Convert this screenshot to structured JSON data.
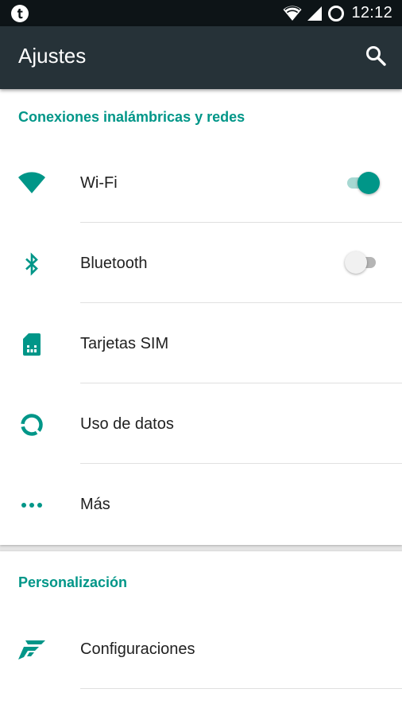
{
  "status_bar": {
    "notification_icon": "tumblr-icon",
    "time": "12:12",
    "icons": [
      "wifi-signal-icon",
      "cell-signal-icon",
      "battery-ring-icon"
    ]
  },
  "app_bar": {
    "title": "Ajustes",
    "search_icon": "search-icon"
  },
  "sections": [
    {
      "title": "Conexiones inalámbricas y redes",
      "items": [
        {
          "label": "Wi-Fi",
          "icon": "wifi-icon",
          "toggle": true,
          "toggle_on": true
        },
        {
          "label": "Bluetooth",
          "icon": "bluetooth-icon",
          "toggle": true,
          "toggle_on": false
        },
        {
          "label": "Tarjetas SIM",
          "icon": "sim-card-icon"
        },
        {
          "label": "Uso de datos",
          "icon": "data-usage-icon"
        },
        {
          "label": "Más",
          "icon": "more-dots-icon"
        }
      ]
    },
    {
      "title": "Personalización",
      "items": [
        {
          "label": "Configuraciones",
          "icon": "themes-icon"
        }
      ]
    }
  ],
  "colors": {
    "accent": "#009688",
    "app_bar": "#263238",
    "status_bar": "#0d1417",
    "background": "#e5e5e5",
    "text_primary": "#212121"
  }
}
